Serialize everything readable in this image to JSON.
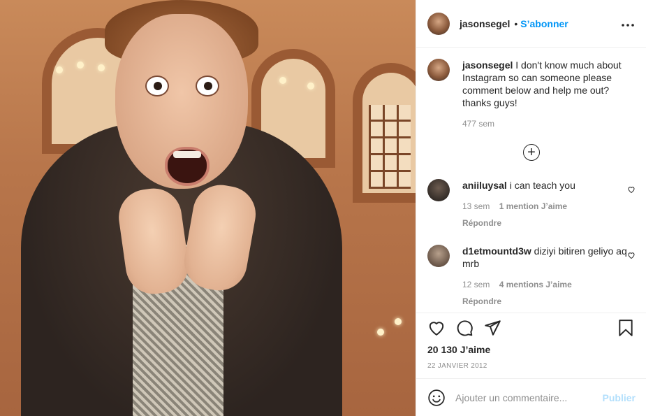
{
  "header": {
    "username": "jasonsegel",
    "dot": "•",
    "follow_label": "S’abonner",
    "more_icon": "more-horizontal-icon"
  },
  "caption": {
    "username": "jasonsegel",
    "text": "I don't know much about Instagram so can someone please comment below and help me out? thanks guys!",
    "time": "477 sem"
  },
  "load_more_icon": "plus-circle-icon",
  "comments": [
    {
      "username": "aniiluysal",
      "text": "i can teach you",
      "time": "13 sem",
      "likes": "1 mention J’aime",
      "reply": "Répondre"
    },
    {
      "username": "d1etmountd3w",
      "text": "diziyi bitiren geliyo aq mrb",
      "time": "12 sem",
      "likes": "4 mentions J’aime",
      "reply": "Répondre"
    }
  ],
  "actions": {
    "like_icon": "heart-icon",
    "comment_icon": "comment-icon",
    "share_icon": "paper-plane-icon",
    "save_icon": "bookmark-icon"
  },
  "likes_count": "20 130 J’aime",
  "post_date": "22 JANVIER 2012",
  "add_comment": {
    "emoji_icon": "smiley-icon",
    "placeholder": "Ajouter un commentaire...",
    "publish_label": "Publier"
  },
  "colors": {
    "accent": "#0095f6",
    "publish_disabled": "#b2dffc",
    "muted": "#8e8e8e",
    "text": "#262626"
  }
}
